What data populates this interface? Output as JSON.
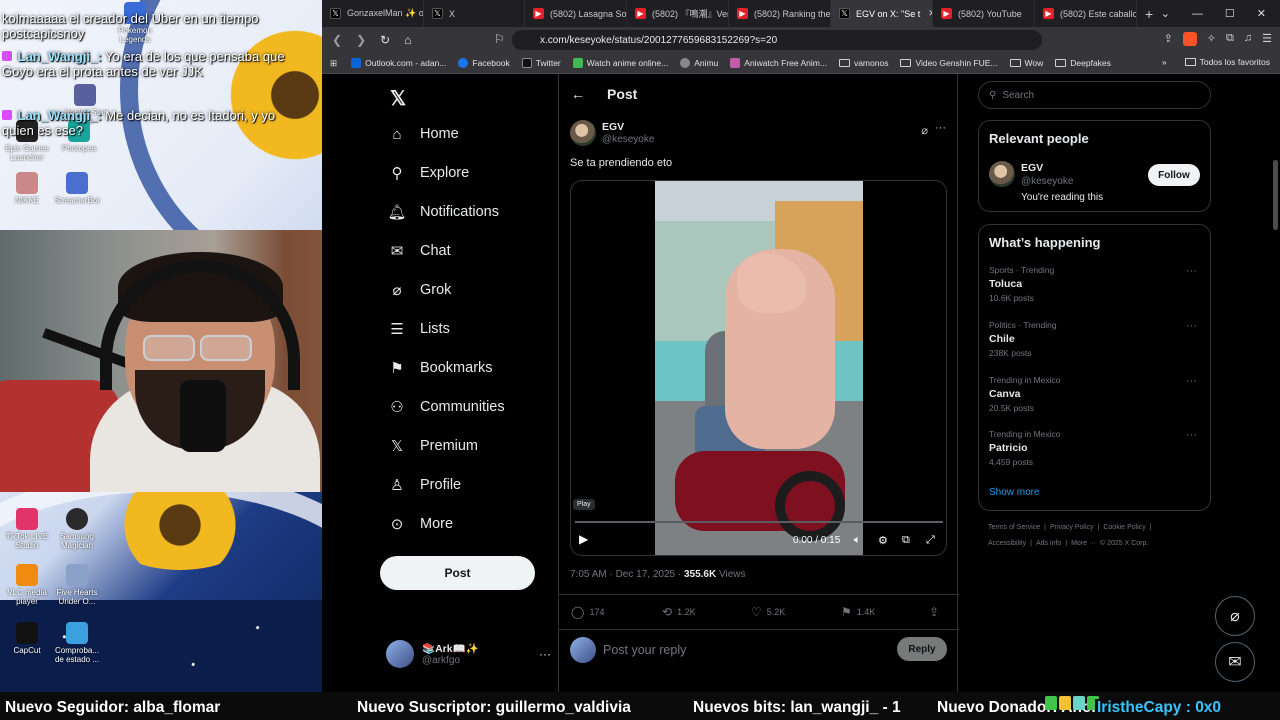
{
  "overlay": {
    "chat": [
      {
        "text": "kolmaaaaa el creador del Uber en un tiempo"
      },
      {
        "text": "postcapicsnoy"
      },
      {
        "name": "Lan_Wangji_:",
        "text": "Yo era de los que pensaba que Goyo era el prota antes de ver JJK"
      },
      {
        "name": "Lan_Wangji_:",
        "text": "Me decian, no es Itadori, y yo quien es ese?"
      }
    ],
    "desktop_icons": [
      {
        "label": "Pokemon Legends"
      },
      {
        "label": "Honkai Star Rail"
      },
      {
        "label": "Epic Games Launcher"
      },
      {
        "label": "Photopea"
      },
      {
        "label": "NIKKE"
      },
      {
        "label": "StreamerBot"
      },
      {
        "label": "TikTok LIVE Studio"
      },
      {
        "label": "Samsung Magician"
      },
      {
        "label": "VLC media player"
      },
      {
        "label": "Five Hearts Under O..."
      },
      {
        "label": "CapCut"
      },
      {
        "label": "Comproba... de estado ..."
      }
    ]
  },
  "browser": {
    "tabs": [
      {
        "label": "GonzaxelMan ✨ o",
        "icon": "x-favicon"
      },
      {
        "label": "X",
        "icon": "x-favicon"
      },
      {
        "label": "(5802) Lasagna Sou",
        "icon": "youtube-favicon"
      },
      {
        "label": "(5802) 『鳴潮』Ver3.",
        "icon": "youtube-favicon"
      },
      {
        "label": "(5802) Ranking the",
        "icon": "youtube-favicon"
      },
      {
        "label": "EGV on X: \"Se t",
        "icon": "x-favicon",
        "active": true
      },
      {
        "label": "(5802) YouTube",
        "icon": "youtube-favicon"
      },
      {
        "label": "(5802) Este caballo",
        "icon": "youtube-favicon"
      }
    ],
    "url": "x.com/keseyoke/status/2001277659683152269?s=20",
    "bookmarks": [
      {
        "label": "Outlook.com - adan...",
        "color": "#0a64d8"
      },
      {
        "label": "Facebook",
        "color": "#1877f2"
      },
      {
        "label": "Twitter",
        "color": "#000000"
      },
      {
        "label": "Watch anime online...",
        "color": "#3fb950"
      },
      {
        "label": "Animu",
        "color": "#888888"
      },
      {
        "label": "Aniwatch Free Anim...",
        "color": "#c75aa8"
      },
      {
        "label": "vamonos",
        "folder": true
      },
      {
        "label": "Video Genshin FUE...",
        "folder": true
      },
      {
        "label": "Wow",
        "folder": true
      },
      {
        "label": "Deepfakes",
        "folder": true
      }
    ],
    "bookmarks_right": "Todos los favoritos"
  },
  "x": {
    "nav": [
      {
        "label": "Home",
        "icon": "home-icon"
      },
      {
        "label": "Explore",
        "icon": "search-icon"
      },
      {
        "label": "Notifications",
        "icon": "bell-icon"
      },
      {
        "label": "Chat",
        "icon": "mail-icon"
      },
      {
        "label": "Grok",
        "icon": "grok-icon"
      },
      {
        "label": "Lists",
        "icon": "list-icon"
      },
      {
        "label": "Bookmarks",
        "icon": "bookmark-icon"
      },
      {
        "label": "Communities",
        "icon": "people-icon"
      },
      {
        "label": "Premium",
        "icon": "x-icon"
      },
      {
        "label": "Profile",
        "icon": "person-icon"
      },
      {
        "label": "More",
        "icon": "more-circle-icon"
      }
    ],
    "post_button": "Post",
    "account": {
      "name": "📚Ark📖✨",
      "handle": "@arkfgo"
    },
    "header_title": "Post",
    "post": {
      "author_name": "EGV",
      "author_handle": "@keseyoke",
      "text": "Se ta prendiendo eto",
      "video_tooltip": "Play",
      "video_time": "0:00 / 0:15",
      "video_progress": 0,
      "timestamp": "7:05 AM · Dec 17, 2025 · ",
      "views_count": "355.6K",
      "views_label": " Views",
      "replies": "174",
      "reposts": "1.2K",
      "likes": "5.2K",
      "bookmarks": "1.4K"
    },
    "reply_placeholder": "Post your reply",
    "reply_button": "Reply",
    "search_placeholder": "Search",
    "relevant": {
      "title": "Relevant people",
      "name": "EGV",
      "handle": "@keseyoke",
      "bio": "You're reading this",
      "follow": "Follow"
    },
    "happening": {
      "title": "What’s happening",
      "trends": [
        {
          "category": "Sports · Trending",
          "name": "Toluca",
          "count": "10.6K posts"
        },
        {
          "category": "Politics · Trending",
          "name": "Chile",
          "count": "238K posts"
        },
        {
          "category": "Trending in Mexico",
          "name": "Canva",
          "count": "20.5K posts"
        },
        {
          "category": "Trending in Mexico",
          "name": "Patricio",
          "count": "4,459 posts"
        }
      ],
      "show_more": "Show more"
    },
    "footer": [
      "Terms of Service",
      "|",
      "Privacy Policy",
      "|",
      "Cookie Policy",
      "|",
      "Accessibility",
      "|",
      "Ads info",
      "|",
      "More ···",
      "© 2025 X Corp."
    ]
  },
  "ticker": {
    "follower": "Nuevo Seguidor: alba_flomar",
    "sub": "Nuevo Suscriptor: guillermo_valdivia",
    "bits": "Nuevos bits: lan_wangji_ - 1",
    "donor": "Nuevo Donador: Anonymous - $16",
    "user": "IristheCapy : 0x0"
  }
}
